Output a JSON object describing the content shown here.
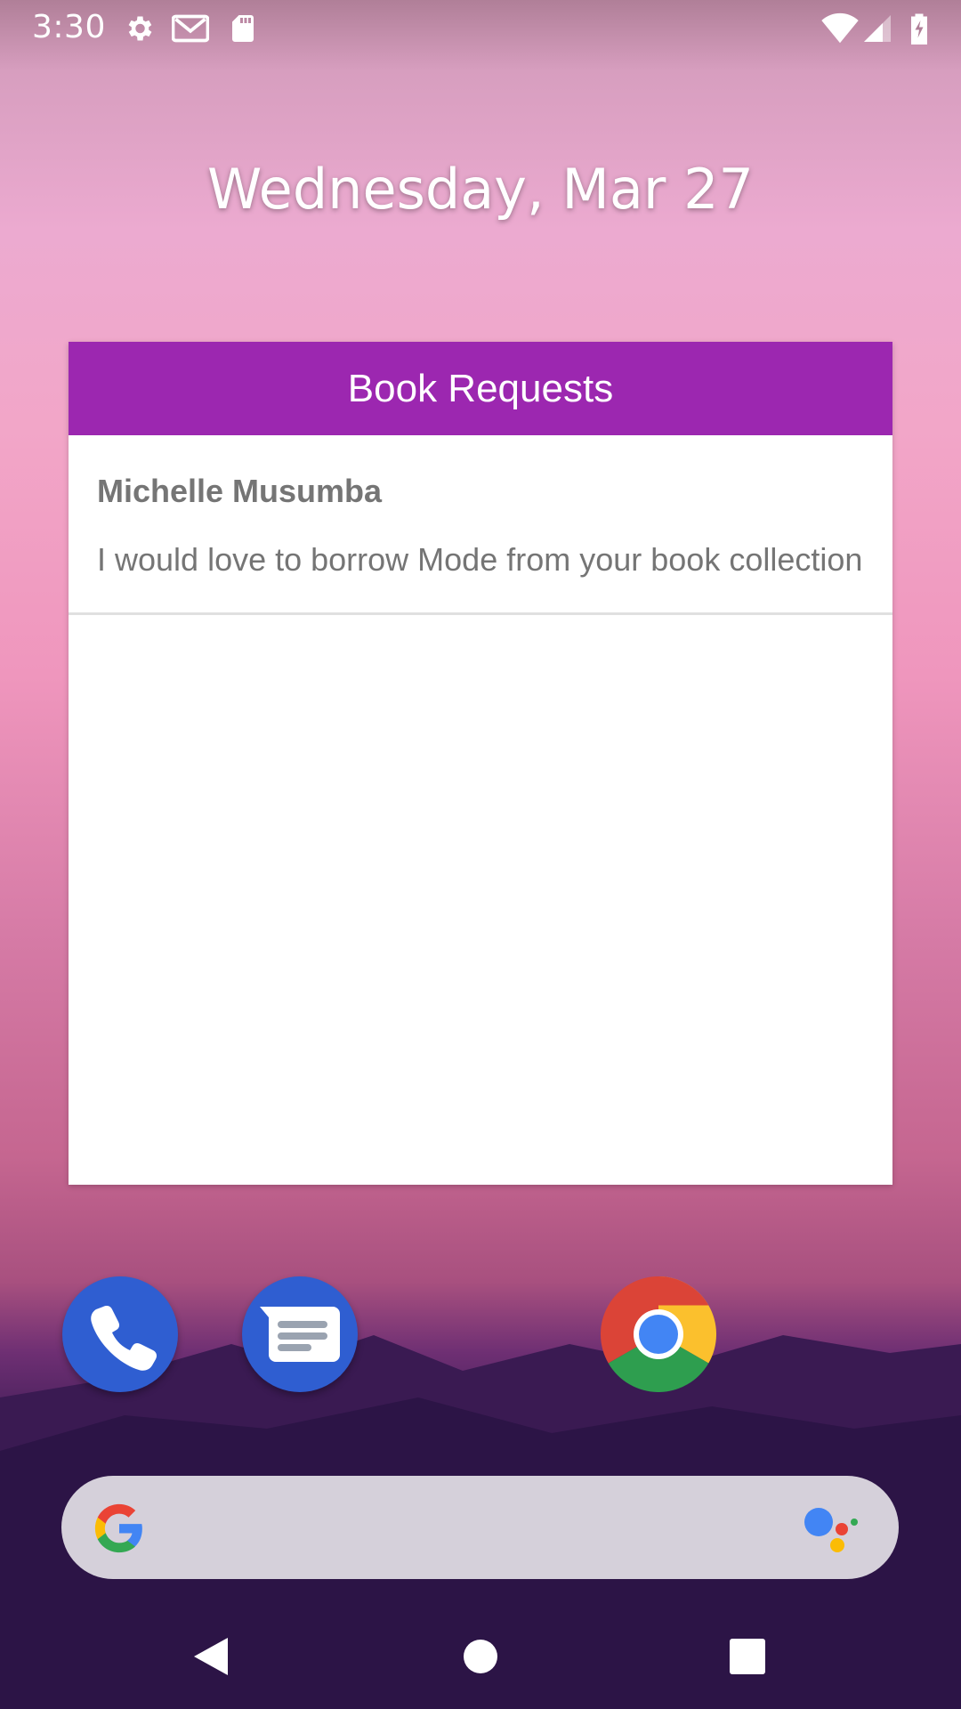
{
  "status_bar": {
    "time": "3:30",
    "icons": [
      "settings-icon",
      "gmail-icon",
      "sd-card-icon",
      "wifi-icon",
      "signal-icon",
      "battery-charging-icon"
    ]
  },
  "home": {
    "date": "Wednesday, Mar 27"
  },
  "widget": {
    "title": "Book Requests",
    "header_color": "#9c27b0",
    "requests": [
      {
        "name": "Michelle Musumba",
        "message": "I would love to borrow Mode from your book collection"
      }
    ]
  },
  "dock": {
    "apps": [
      "phone-icon",
      "messages-icon",
      "chrome-icon"
    ]
  },
  "search": {
    "icons": [
      "google-g-icon",
      "google-assistant-icon"
    ]
  },
  "nav": {
    "buttons": [
      "back-icon",
      "home-icon",
      "recents-icon"
    ]
  }
}
